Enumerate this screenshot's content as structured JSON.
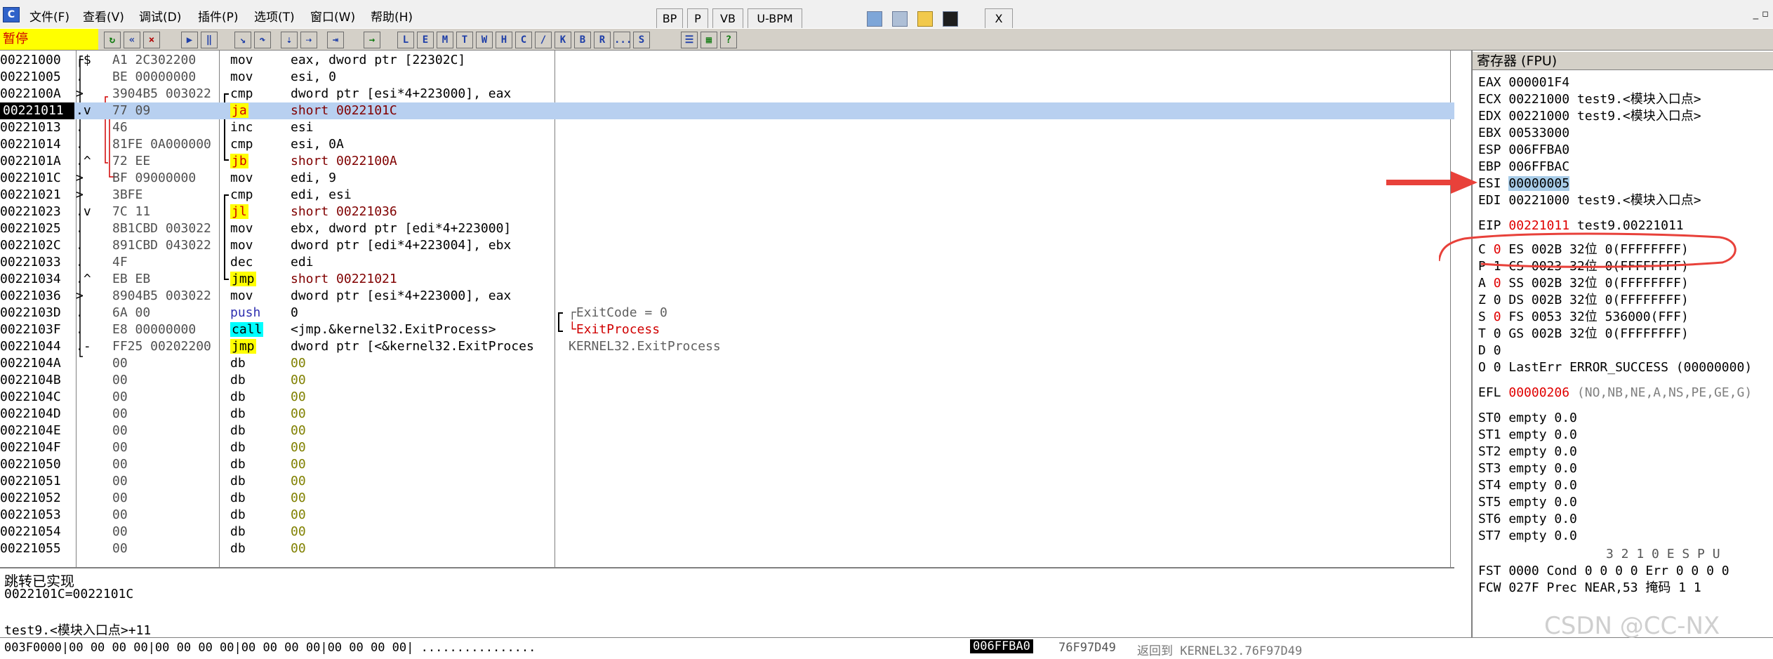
{
  "menu": {
    "items": [
      "文件(F)",
      "查看(V)",
      "调试(D)",
      "插件(P)",
      "选项(T)",
      "窗口(W)",
      "帮助(H)"
    ],
    "mini_buttons": [
      "BP",
      "P",
      "VB",
      "U-BPM"
    ],
    "close": "X",
    "win_ctrl": "_ ▫"
  },
  "toolbar": {
    "status": "暂停",
    "buttons": [
      "L",
      "E",
      "M",
      "T",
      "W",
      "H",
      "C",
      "/",
      "K",
      "B",
      "R",
      "...",
      "S"
    ]
  },
  "disasm_rows": [
    {
      "addr": "00221000",
      "mark": "┌$",
      "bytes": "A1 2C302200",
      "mnem": "mov",
      "ops": "eax, dword ptr [22302C]",
      "comment": ""
    },
    {
      "addr": "00221005",
      "mark": ".",
      "bytes": "BE 00000000",
      "mnem": "mov",
      "ops": "esi, 0",
      "comment": ""
    },
    {
      "addr": "0022100A",
      "mark": ">",
      "bytes": "3904B5 003022",
      "mnem": "cmp",
      "ops": "dword ptr [esi*4+223000], eax",
      "comment": ""
    },
    {
      "addr": "00221011",
      "mark": ".v",
      "bytes": "77 09",
      "mnem": "ja",
      "ops": "short 0022101C",
      "comment": ""
    },
    {
      "addr": "00221013",
      "mark": ".",
      "bytes": "46",
      "mnem": "inc",
      "ops": "esi",
      "comment": ""
    },
    {
      "addr": "00221014",
      "mark": ".",
      "bytes": "81FE 0A000000",
      "mnem": "cmp",
      "ops": "esi, 0A",
      "comment": ""
    },
    {
      "addr": "0022101A",
      "mark": ".^",
      "bytes": "72 EE",
      "mnem": "jb",
      "ops": "short 0022100A",
      "comment": ""
    },
    {
      "addr": "0022101C",
      "mark": ">",
      "bytes": "BF 09000000",
      "mnem": "mov",
      "ops": "edi, 9",
      "comment": ""
    },
    {
      "addr": "00221021",
      "mark": ">",
      "bytes": "3BFE",
      "mnem": "cmp",
      "ops": "edi, esi",
      "comment": ""
    },
    {
      "addr": "00221023",
      "mark": ".v",
      "bytes": "7C 11",
      "mnem": "jl",
      "ops": "short 00221036",
      "comment": ""
    },
    {
      "addr": "00221025",
      "mark": ".",
      "bytes": "8B1CBD 003022",
      "mnem": "mov",
      "ops": "ebx, dword ptr [edi*4+223000]",
      "comment": ""
    },
    {
      "addr": "0022102C",
      "mark": ".",
      "bytes": "891CBD 043022",
      "mnem": "mov",
      "ops": "dword ptr [edi*4+223004], ebx",
      "comment": ""
    },
    {
      "addr": "00221033",
      "mark": ".",
      "bytes": "4F",
      "mnem": "dec",
      "ops": "edi",
      "comment": ""
    },
    {
      "addr": "00221034",
      "mark": ".^",
      "bytes": "EB EB",
      "mnem": "jmp",
      "ops": "short 00221021",
      "comment": ""
    },
    {
      "addr": "00221036",
      "mark": ">",
      "bytes": "8904B5 003022",
      "mnem": "mov",
      "ops": "dword ptr [esi*4+223000], eax",
      "comment": ""
    },
    {
      "addr": "0022103D",
      "mark": ".",
      "bytes": "6A 00",
      "mnem": "push",
      "ops": "0",
      "comment": "┌ExitCode = 0"
    },
    {
      "addr": "0022103F",
      "mark": ".",
      "bytes": "E8 00000000",
      "mnem": "call",
      "ops": "<jmp.&kernel32.ExitProcess>",
      "comment": "└ExitProcess"
    },
    {
      "addr": "00221044",
      "mark": ".-",
      "bytes": "FF25 00202200",
      "mnem": "jmp",
      "ops": "dword ptr [<&kernel32.ExitProces",
      "comment": "KERNEL32.ExitProcess"
    },
    {
      "addr": "0022104A",
      "mark": "",
      "bytes": "00",
      "mnem": "db",
      "ops": "00",
      "comment": ""
    },
    {
      "addr": "0022104B",
      "mark": "",
      "bytes": "00",
      "mnem": "db",
      "ops": "00",
      "comment": ""
    },
    {
      "addr": "0022104C",
      "mark": "",
      "bytes": "00",
      "mnem": "db",
      "ops": "00",
      "comment": ""
    },
    {
      "addr": "0022104D",
      "mark": "",
      "bytes": "00",
      "mnem": "db",
      "ops": "00",
      "comment": ""
    },
    {
      "addr": "0022104E",
      "mark": "",
      "bytes": "00",
      "mnem": "db",
      "ops": "00",
      "comment": ""
    },
    {
      "addr": "0022104F",
      "mark": "",
      "bytes": "00",
      "mnem": "db",
      "ops": "00",
      "comment": ""
    },
    {
      "addr": "00221050",
      "mark": "",
      "bytes": "00",
      "mnem": "db",
      "ops": "00",
      "comment": ""
    },
    {
      "addr": "00221051",
      "mark": "",
      "bytes": "00",
      "mnem": "db",
      "ops": "00",
      "comment": ""
    },
    {
      "addr": "00221052",
      "mark": "",
      "bytes": "00",
      "mnem": "db",
      "ops": "00",
      "comment": ""
    },
    {
      "addr": "00221053",
      "mark": "",
      "bytes": "00",
      "mnem": "db",
      "ops": "00",
      "comment": ""
    },
    {
      "addr": "00221054",
      "mark": "",
      "bytes": "00",
      "mnem": "db",
      "ops": "00",
      "comment": ""
    },
    {
      "addr": "00221055",
      "mark": "",
      "bytes": "00",
      "mnem": "db",
      "ops": "00",
      "comment": ""
    }
  ],
  "asm_info": {
    "line1": "跳转已实现",
    "line2": "0022101C=0022101C",
    "line3": "test9.<模块入口点>+11"
  },
  "registers": {
    "title": "寄存器 (FPU)",
    "eax": {
      "name": "EAX",
      "val": "000001F4",
      "info": ""
    },
    "ecx": {
      "name": "ECX",
      "val": "00221000",
      "info": "test9.<模块入口点>"
    },
    "edx": {
      "name": "EDX",
      "val": "00221000",
      "info": "test9.<模块入口点>"
    },
    "ebx": {
      "name": "EBX",
      "val": "00533000",
      "info": ""
    },
    "esp": {
      "name": "ESP",
      "val": "006FFBA0",
      "info": ""
    },
    "ebp": {
      "name": "EBP",
      "val": "006FFBAC",
      "info": ""
    },
    "esi": {
      "name": "ESI",
      "val": "00000005",
      "info": ""
    },
    "edi": {
      "name": "EDI",
      "val": "00221000",
      "info": "test9.<模块入口点>"
    },
    "eip": {
      "name": "EIP",
      "val": "00221011",
      "info": "test9.00221011"
    },
    "flags": [
      {
        "f": "C",
        "v": "0",
        "seg": "ES 002B 32位 0(FFFFFFFF)"
      },
      {
        "f": "P",
        "v": "1",
        "seg": "CS 0023 32位 0(FFFFFFFF)"
      },
      {
        "f": "A",
        "v": "0",
        "seg": "SS 002B 32位 0(FFFFFFFF)"
      },
      {
        "f": "Z",
        "v": "0",
        "seg": "DS 002B 32位 0(FFFFFFFF)"
      },
      {
        "f": "S",
        "v": "0",
        "seg": "FS 0053 32位 536000(FFF)"
      },
      {
        "f": "T",
        "v": "0",
        "seg": "GS 002B 32位 0(FFFFFFFF)"
      },
      {
        "f": "D",
        "v": "0",
        "seg": ""
      },
      {
        "f": "O",
        "v": "0",
        "seg": "LastErr ERROR_SUCCESS (00000000)"
      }
    ],
    "efl": {
      "name": "EFL",
      "val": "00000206",
      "info": "(NO,NB,NE,A,NS,PE,GE,G)"
    },
    "fpu": [
      "ST0 empty 0.0",
      "ST1 empty 0.0",
      "ST2 empty 0.0",
      "ST3 empty 0.0",
      "ST4 empty 0.0",
      "ST5 empty 0.0",
      "ST6 empty 0.0",
      "ST7 empty 0.0"
    ],
    "fpu_hdr": "3 2 1 0      E S P U",
    "fst": "FST 0000  Cond 0 0 0 0  Err 0 0 0 0",
    "fcw": "FCW 027F  Prec NEAR,53  掩码    1 1"
  },
  "bottom": {
    "left": "003F0000|00 00 00 00|00 00 00 00|00 00 00 00|00 00 00 00| ................",
    "right_addr": "006FFBA0",
    "right_val": "76F97D49",
    "right_comment": "返回到 KERNEL32.76F97D49"
  },
  "watermark": "CSDN @CC-NX",
  "colors": {
    "highlight_row": "#b8d0f0",
    "jcc_bg": "#ffff00",
    "call_bg": "#00ffff",
    "accent_red": "#d00000"
  }
}
